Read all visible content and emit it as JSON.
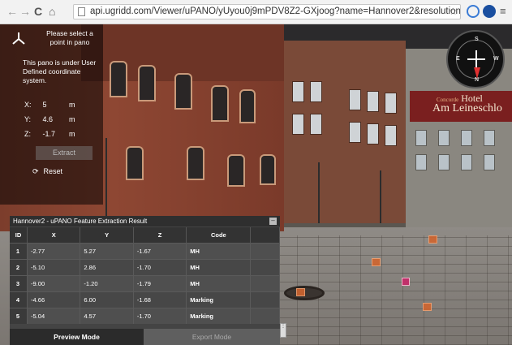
{
  "browser": {
    "url": "api.ugridd.com/Viewer/uPANO/yUyou0j9mPDV8Z2-GXjoog?name=Hannover2&resolution=2048&meas",
    "back_icon": "arrow-left",
    "forward_icon": "arrow-right",
    "reload_icon": "reload",
    "home_icon": "home",
    "star_icon": "star",
    "menu_icon": "hamburger"
  },
  "overlay": {
    "instruction": "Please select a point in pano",
    "status_message": "This pano is under User Defined coordinate system.",
    "coords": [
      {
        "axis": "X:",
        "value": "5",
        "unit": "m"
      },
      {
        "axis": "Y:",
        "value": "4.6",
        "unit": "m"
      },
      {
        "axis": "Z:",
        "value": "-1.7",
        "unit": "m"
      }
    ],
    "extract_label": "Extract",
    "reset_label": "Reset"
  },
  "scene": {
    "hotel_sign_line1": "Hotel",
    "hotel_sign_line2": "Am Leineschlo",
    "hotel_sign_prefix": "Concorde"
  },
  "compass": {
    "n": "N",
    "s": "S",
    "e": "E",
    "w": "W"
  },
  "results": {
    "title": "Hannover2 - uPANO Feature Extraction Result",
    "minimize": "–",
    "columns": [
      "ID",
      "X",
      "Y",
      "Z",
      "Code"
    ],
    "rows": [
      {
        "id": "1",
        "x": "-2.77",
        "y": "5.27",
        "z": "-1.67",
        "code": "MH"
      },
      {
        "id": "2",
        "x": "-5.10",
        "y": "2.86",
        "z": "-1.70",
        "code": "MH"
      },
      {
        "id": "3",
        "x": "-9.00",
        "y": "-1.20",
        "z": "-1.79",
        "code": "MH"
      },
      {
        "id": "4",
        "x": "-4.66",
        "y": "6.00",
        "z": "-1.68",
        "code": "Marking"
      },
      {
        "id": "5",
        "x": "-5.04",
        "y": "4.57",
        "z": "-1.70",
        "code": "Marking"
      }
    ],
    "tab_preview": "Preview Mode",
    "tab_export": "Export Mode"
  }
}
